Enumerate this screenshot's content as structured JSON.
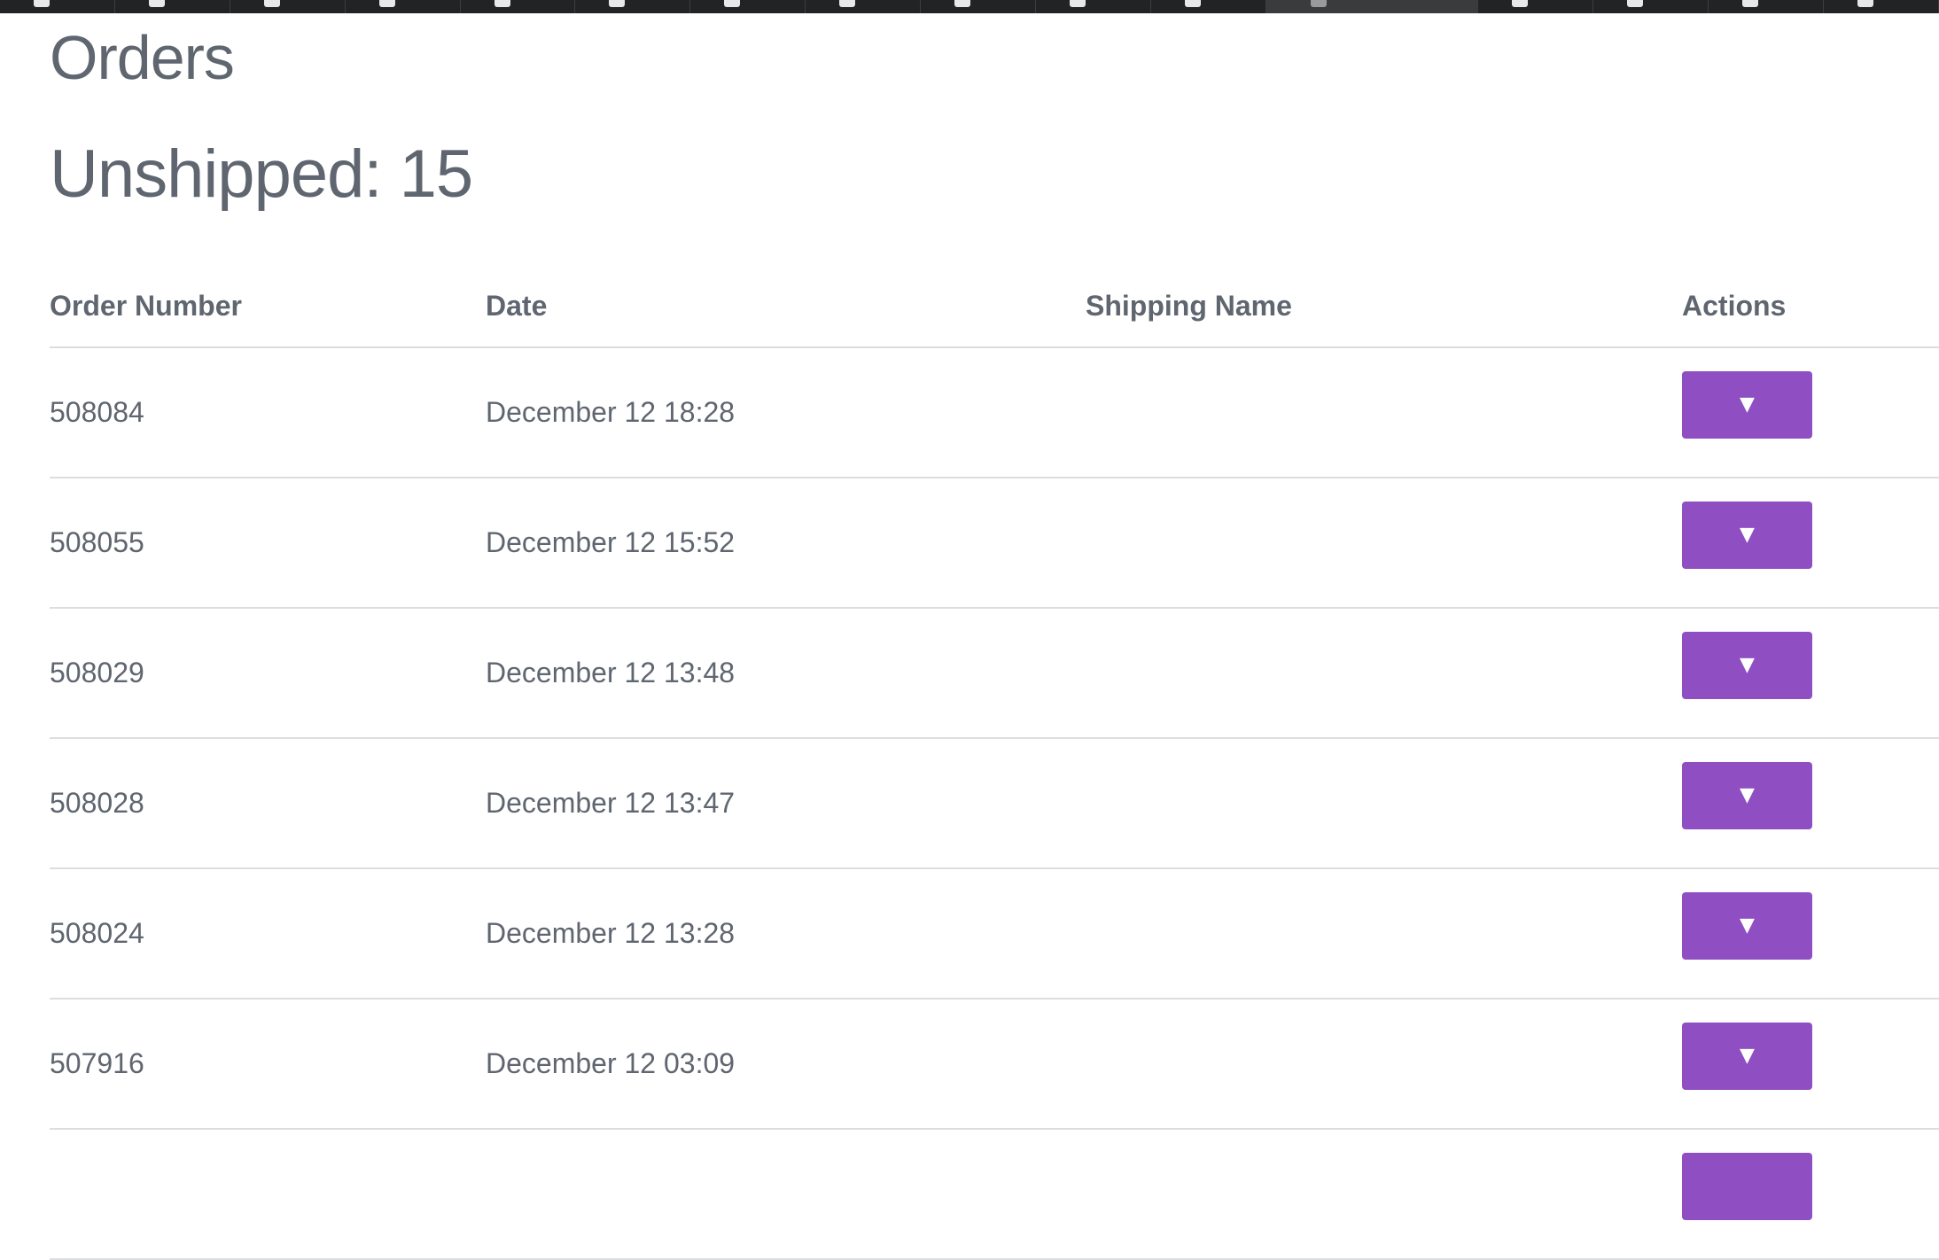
{
  "page": {
    "title": "Orders",
    "subtitle": "Unshipped: 15"
  },
  "table": {
    "headers": {
      "order_number": "Order Number",
      "date": "Date",
      "shipping_name": "Shipping Name",
      "actions": "Actions"
    },
    "rows": [
      {
        "order_number": "508084",
        "date": "December 12 18:28",
        "shipping_name": "",
        "action_glyph": "▼"
      },
      {
        "order_number": "508055",
        "date": "December 12 15:52",
        "shipping_name": "",
        "action_glyph": "▼"
      },
      {
        "order_number": "508029",
        "date": "December 12 13:48",
        "shipping_name": "",
        "action_glyph": "▼"
      },
      {
        "order_number": "508028",
        "date": "December 12 13:47",
        "shipping_name": "",
        "action_glyph": "▼"
      },
      {
        "order_number": "508024",
        "date": "December 12 13:28",
        "shipping_name": "",
        "action_glyph": "▼"
      },
      {
        "order_number": "507916",
        "date": "December 12 03:09",
        "shipping_name": "",
        "action_glyph": "▼"
      },
      {
        "order_number": "",
        "date": "",
        "shipping_name": "",
        "action_glyph": ""
      }
    ]
  },
  "colors": {
    "action_button": "#8f4fc2",
    "text": "#5f6670",
    "divider": "#dcdde0",
    "tabbar": "#222324"
  }
}
